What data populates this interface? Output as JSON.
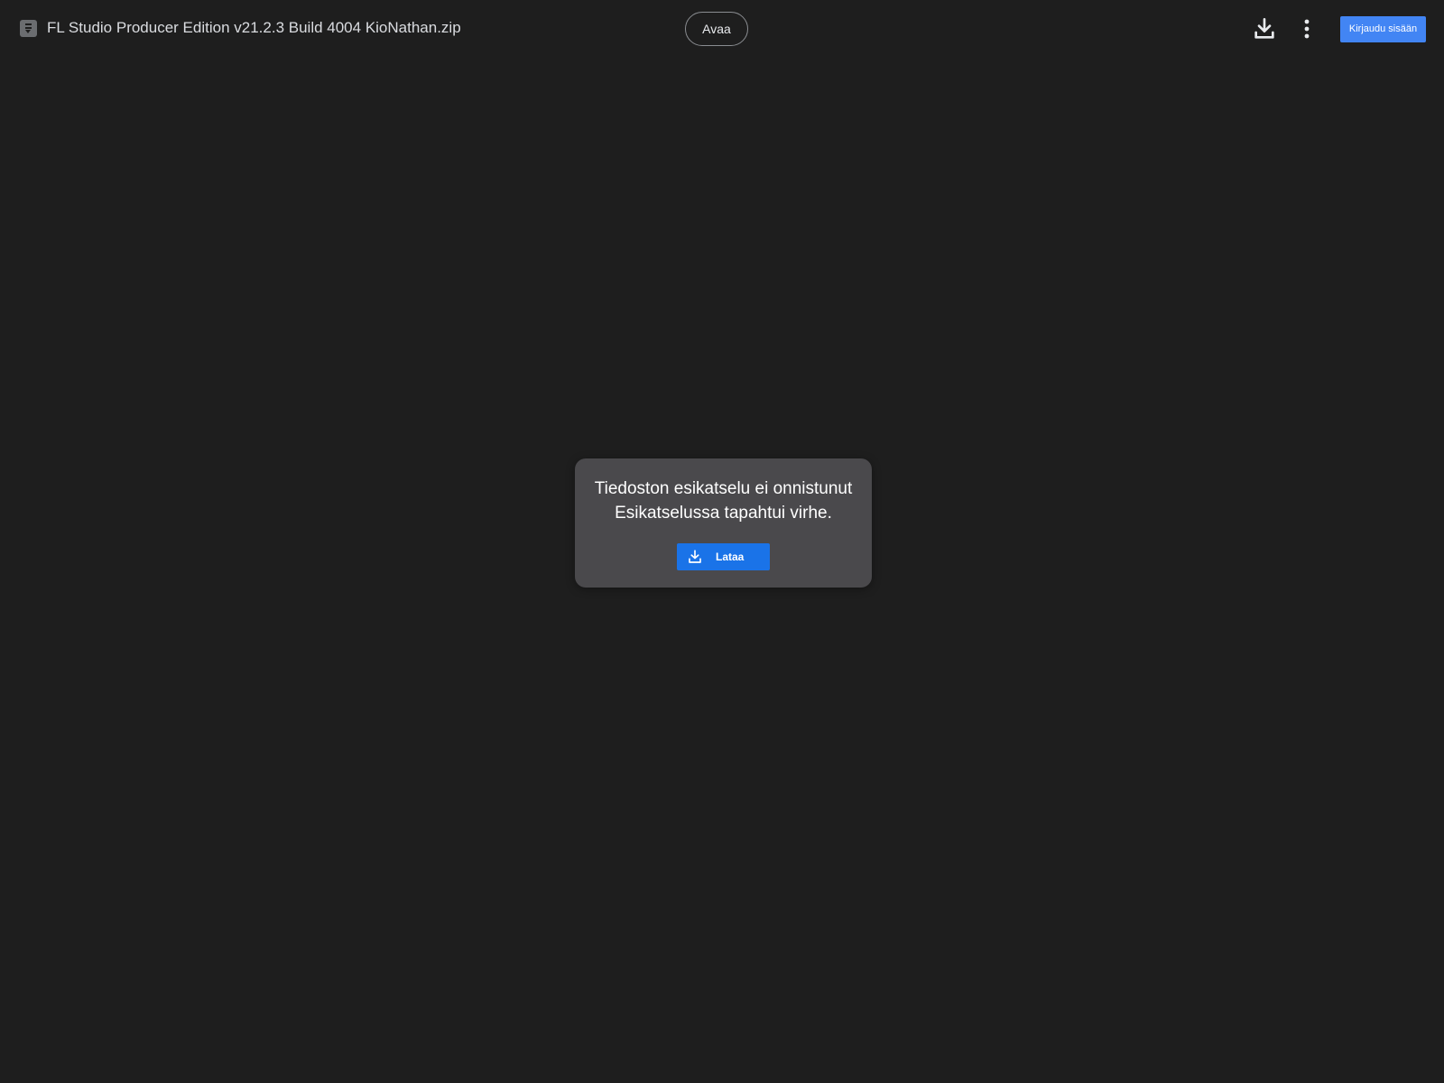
{
  "header": {
    "file_name": "FL Studio Producer Edition v21.2.3 Build 4004 KioNathan.zip",
    "open_label": "Avaa",
    "signin_label": "Kirjaudu sisään",
    "icons": {
      "file": "archive-file-icon",
      "download": "download-icon",
      "more": "more-vert-icon"
    }
  },
  "error": {
    "title": "Tiedoston esikatselu ei onnistunut",
    "message": "Esikatselussa tapahtui virhe.",
    "download_label": "Lataa"
  },
  "colors": {
    "background": "#1e1e1e",
    "card": "#4a494c",
    "primary_button": "#1a73e8",
    "signin_button": "#4285f4"
  }
}
